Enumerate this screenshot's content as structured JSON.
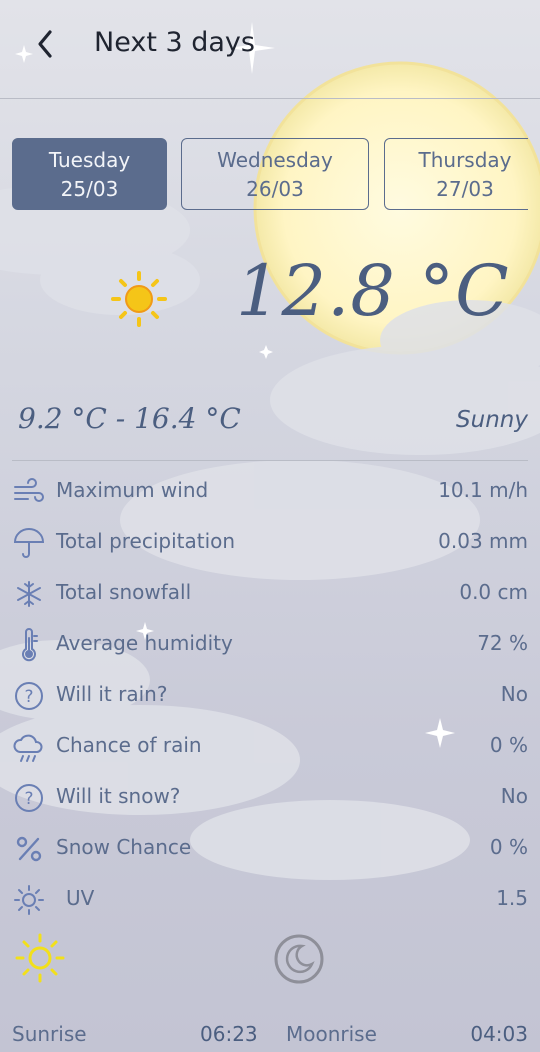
{
  "header": {
    "title": "Next 3 days",
    "back_icon": "chevron-left-icon"
  },
  "tabs": [
    {
      "day": "Tuesday",
      "date": "25/03",
      "active": true
    },
    {
      "day": "Wednesday",
      "date": "26/03",
      "active": false
    },
    {
      "day": "Thursday",
      "date": "27/03",
      "active": false
    }
  ],
  "current": {
    "temperature": "12.8 °C",
    "range": "9.2 °C - 16.4 °C",
    "condition": "Sunny",
    "icon": "sun-icon"
  },
  "details": [
    {
      "icon": "wind-icon",
      "label": "Maximum wind",
      "value": "10.1 m/h"
    },
    {
      "icon": "umbrella-icon",
      "label": "Total precipitation",
      "value": "0.03 mm"
    },
    {
      "icon": "snowflake-icon",
      "label": "Total snowfall",
      "value": "0.0 cm"
    },
    {
      "icon": "thermometer-icon",
      "label": "Average humidity",
      "value": "72 %"
    },
    {
      "icon": "question-icon",
      "label": "Will it rain?",
      "value": "No"
    },
    {
      "icon": "rain-cloud-icon",
      "label": "Chance of rain",
      "value": "0 %"
    },
    {
      "icon": "question-icon",
      "label": "Will it snow?",
      "value": "No"
    },
    {
      "icon": "percent-icon",
      "label": "Snow Chance",
      "value": "0 %"
    },
    {
      "icon": "uv-sun-icon",
      "label": "UV",
      "value": "1.5"
    }
  ],
  "astro": {
    "sunrise_label": "Sunrise",
    "sunrise": "06:23",
    "moonrise_label": "Moonrise",
    "moonrise": "04:03"
  },
  "colors": {
    "accent": "#5b6c8d",
    "sun": "#f5c518",
    "moon": "#fff5c4"
  }
}
